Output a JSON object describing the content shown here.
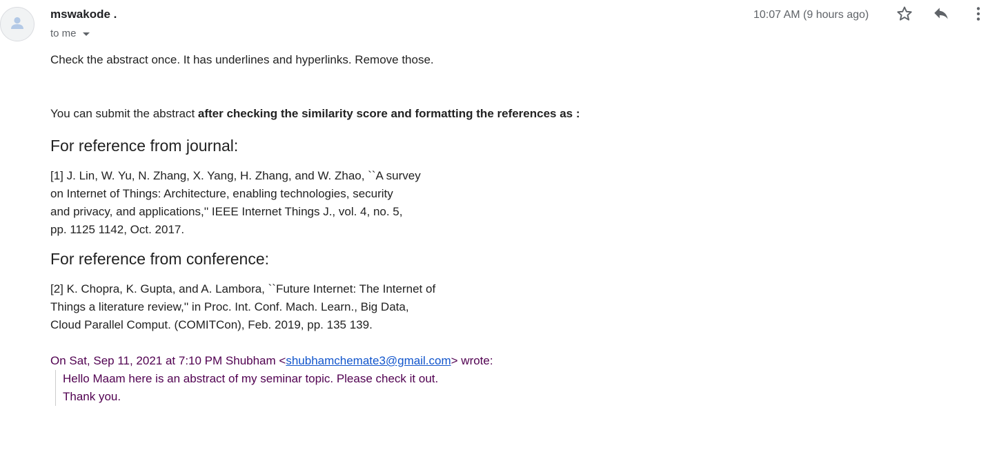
{
  "header": {
    "sender": "mswakode .",
    "to_label": "to me",
    "time": "10:07 AM (9 hours ago)",
    "icons": [
      "person-icon",
      "star-icon",
      "reply-icon",
      "more-vert-icon"
    ]
  },
  "body": {
    "line1": "Check the abstract once. It has underlines and hyperlinks. Remove those.",
    "line2_plain": "You can submit the abstract ",
    "line2_bold": "after checking the similarity score and formatting the references as :",
    "journal_heading": "For reference from journal:",
    "journal_ref": [
      "[1] J. Lin, W. Yu, N. Zhang, X. Yang, H. Zhang, and W. Zhao, ``A survey",
      "on Internet of Things: Architecture, enabling technologies, security",
      "and privacy, and applications,'' IEEE Internet Things J., vol. 4, no. 5,",
      "pp. 1125 1142, Oct. 2017."
    ],
    "conference_heading": "For reference from conference:",
    "conference_ref": [
      "[2] K. Chopra, K. Gupta, and A. Lambora, ``Future Internet: The Internet of",
      "Things a literature review,'' in Proc. Int. Conf. Mach. Learn., Big Data,",
      "Cloud Parallel Comput. (COMITCon), Feb. 2019, pp. 135 139."
    ]
  },
  "quote": {
    "intro_before": "On Sat, Sep 11, 2021 at 7:10 PM Shubham <",
    "email": "shubhamchemate3@gmail.com",
    "intro_after": "> wrote:",
    "lines": [
      "Hello Maam here is an abstract of my seminar topic. Please check it out.",
      "Thank you."
    ]
  },
  "colors": {
    "quote_text": "#500050",
    "link": "#1155cc",
    "muted": "#5f6368"
  }
}
